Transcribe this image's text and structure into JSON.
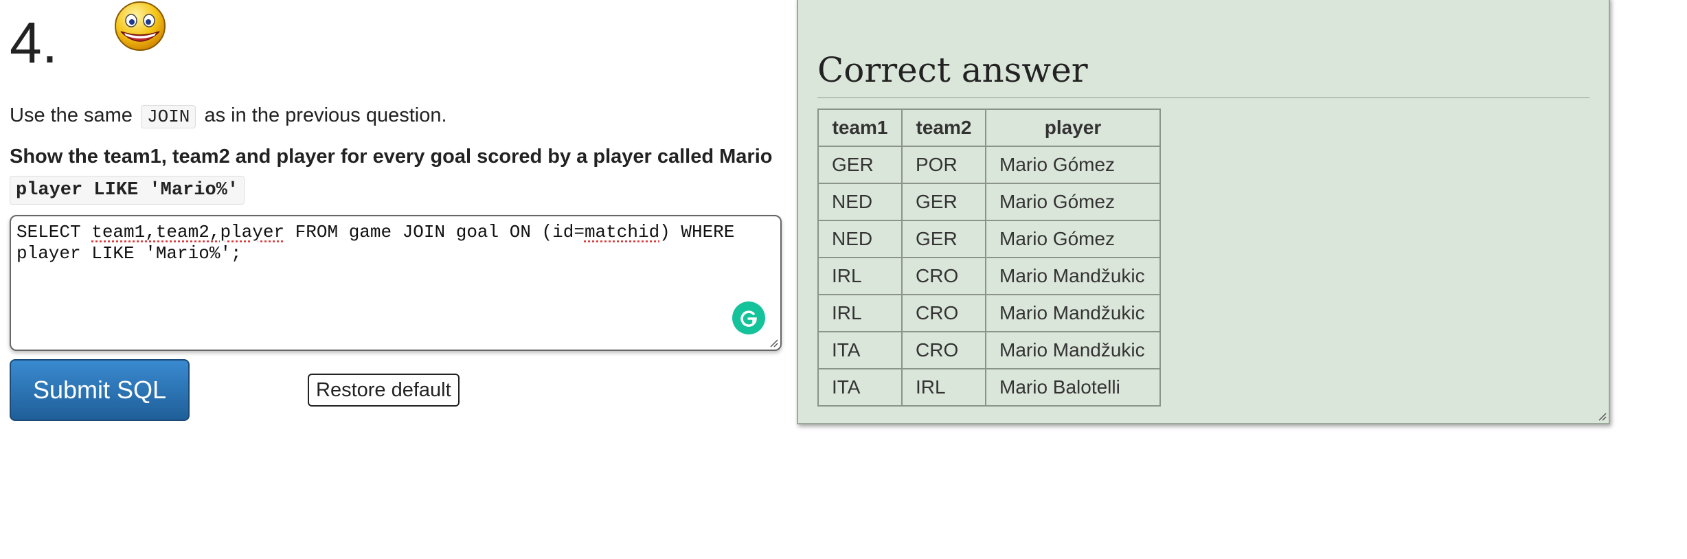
{
  "question": {
    "number": "4.",
    "intro_before": "Use the same",
    "intro_code": "JOIN",
    "intro_after": "as in the previous question.",
    "task": "Show the team1, team2 and player for every goal scored by a player called Mario",
    "hint": "player LIKE 'Mario%'"
  },
  "editor": {
    "sql_parts": [
      "SELECT ",
      "team1,team2,player",
      " FROM game JOIN goal ON (id=",
      "matchid",
      ") WHERE player LIKE 'Mario%';"
    ],
    "grammarly_icon": "grammarly-g-icon"
  },
  "buttons": {
    "submit": "Submit SQL",
    "restore": "Restore default"
  },
  "answer": {
    "title": "Correct answer",
    "columns": [
      "team1",
      "team2",
      "player"
    ],
    "rows": [
      [
        "GER",
        "POR",
        "Mario Gómez"
      ],
      [
        "NED",
        "GER",
        "Mario Gómez"
      ],
      [
        "NED",
        "GER",
        "Mario Gómez"
      ],
      [
        "IRL",
        "CRO",
        "Mario Mandžukic"
      ],
      [
        "IRL",
        "CRO",
        "Mario Mandžukic"
      ],
      [
        "ITA",
        "CRO",
        "Mario Mandžukic"
      ],
      [
        "ITA",
        "IRL",
        "Mario Balotelli"
      ]
    ]
  },
  "colors": {
    "panel_bg": "#dbe6da",
    "submit_bg": "#2b72b3",
    "grammarly": "#15c39a"
  }
}
